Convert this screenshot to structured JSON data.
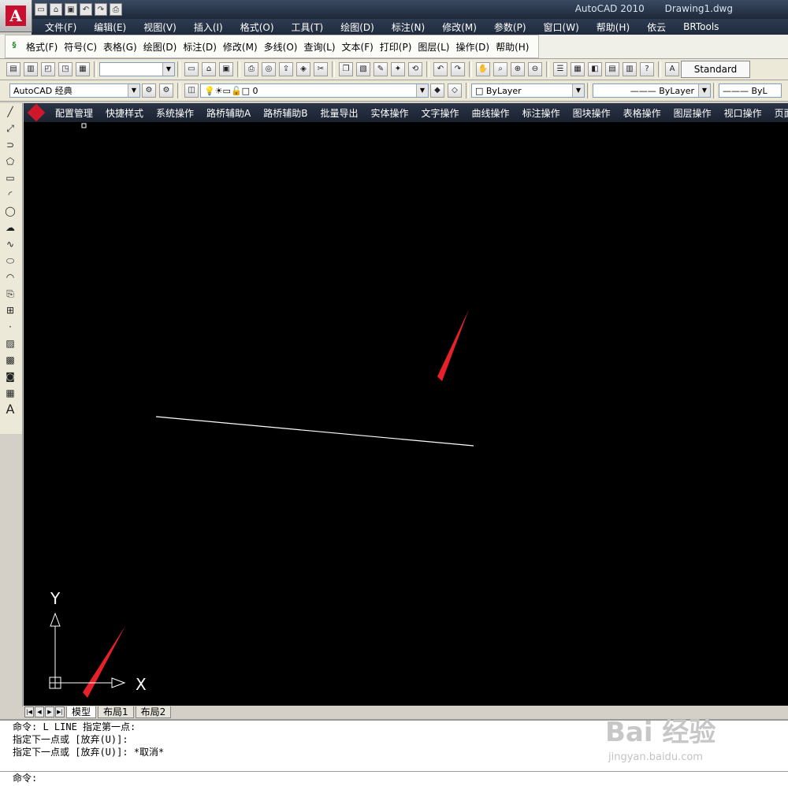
{
  "titlebar": {
    "app_name": "AutoCAD 2010",
    "file_name": "Drawing1.dwg",
    "quick_access": [
      "new-icon",
      "open-icon",
      "save-icon",
      "undo-icon",
      "redo-icon",
      "print-icon"
    ]
  },
  "menubar": {
    "items": [
      "文件(F)",
      "编辑(E)",
      "视图(V)",
      "插入(I)",
      "格式(O)",
      "工具(T)",
      "绘图(D)",
      "标注(N)",
      "修改(M)",
      "参数(P)",
      "窗口(W)",
      "帮助(H)",
      "依云",
      "BRTools"
    ]
  },
  "plugin_menu": {
    "items": [
      "格式(F)",
      "符号(C)",
      "表格(G)",
      "绘图(D)",
      "标注(D)",
      "修改(M)",
      "多线(O)",
      "查询(L)",
      "文本(F)",
      "打印(P)",
      "图层(L)",
      "操作(D)",
      "帮助(H)"
    ]
  },
  "toolbar3": {
    "workspace": "AutoCAD 经典",
    "layer": "0",
    "color": "ByLayer",
    "linetype": "ByLayer",
    "lineweight": "ByL",
    "text_style": "Standard"
  },
  "plugin_bar": {
    "items": [
      "配置管理",
      "快捷样式",
      "系统操作",
      "路桥辅助A",
      "路桥辅助B",
      "批量导出",
      "实体操作",
      "文字操作",
      "曲线操作",
      "标注操作",
      "图块操作",
      "表格操作",
      "图层操作",
      "视口操作",
      "页面操作"
    ]
  },
  "canvas": {
    "ucs_x": "X",
    "ucs_y": "Y"
  },
  "layout_tabs": [
    "模型",
    "布局1",
    "布局2"
  ],
  "command_history": [
    "命令: L LINE 指定第一点:",
    "指定下一点或 [放弃(U)]:",
    "指定下一点或 [放弃(U)]: *取消*"
  ],
  "command_prompt": "命令:",
  "watermark": {
    "logo": "Bai 经验",
    "url": "jingyan.baidu.com"
  },
  "colors": {
    "annotation_arrow": "#e8202a",
    "canvas": "#000000",
    "drawn_line": "#ffffff"
  }
}
